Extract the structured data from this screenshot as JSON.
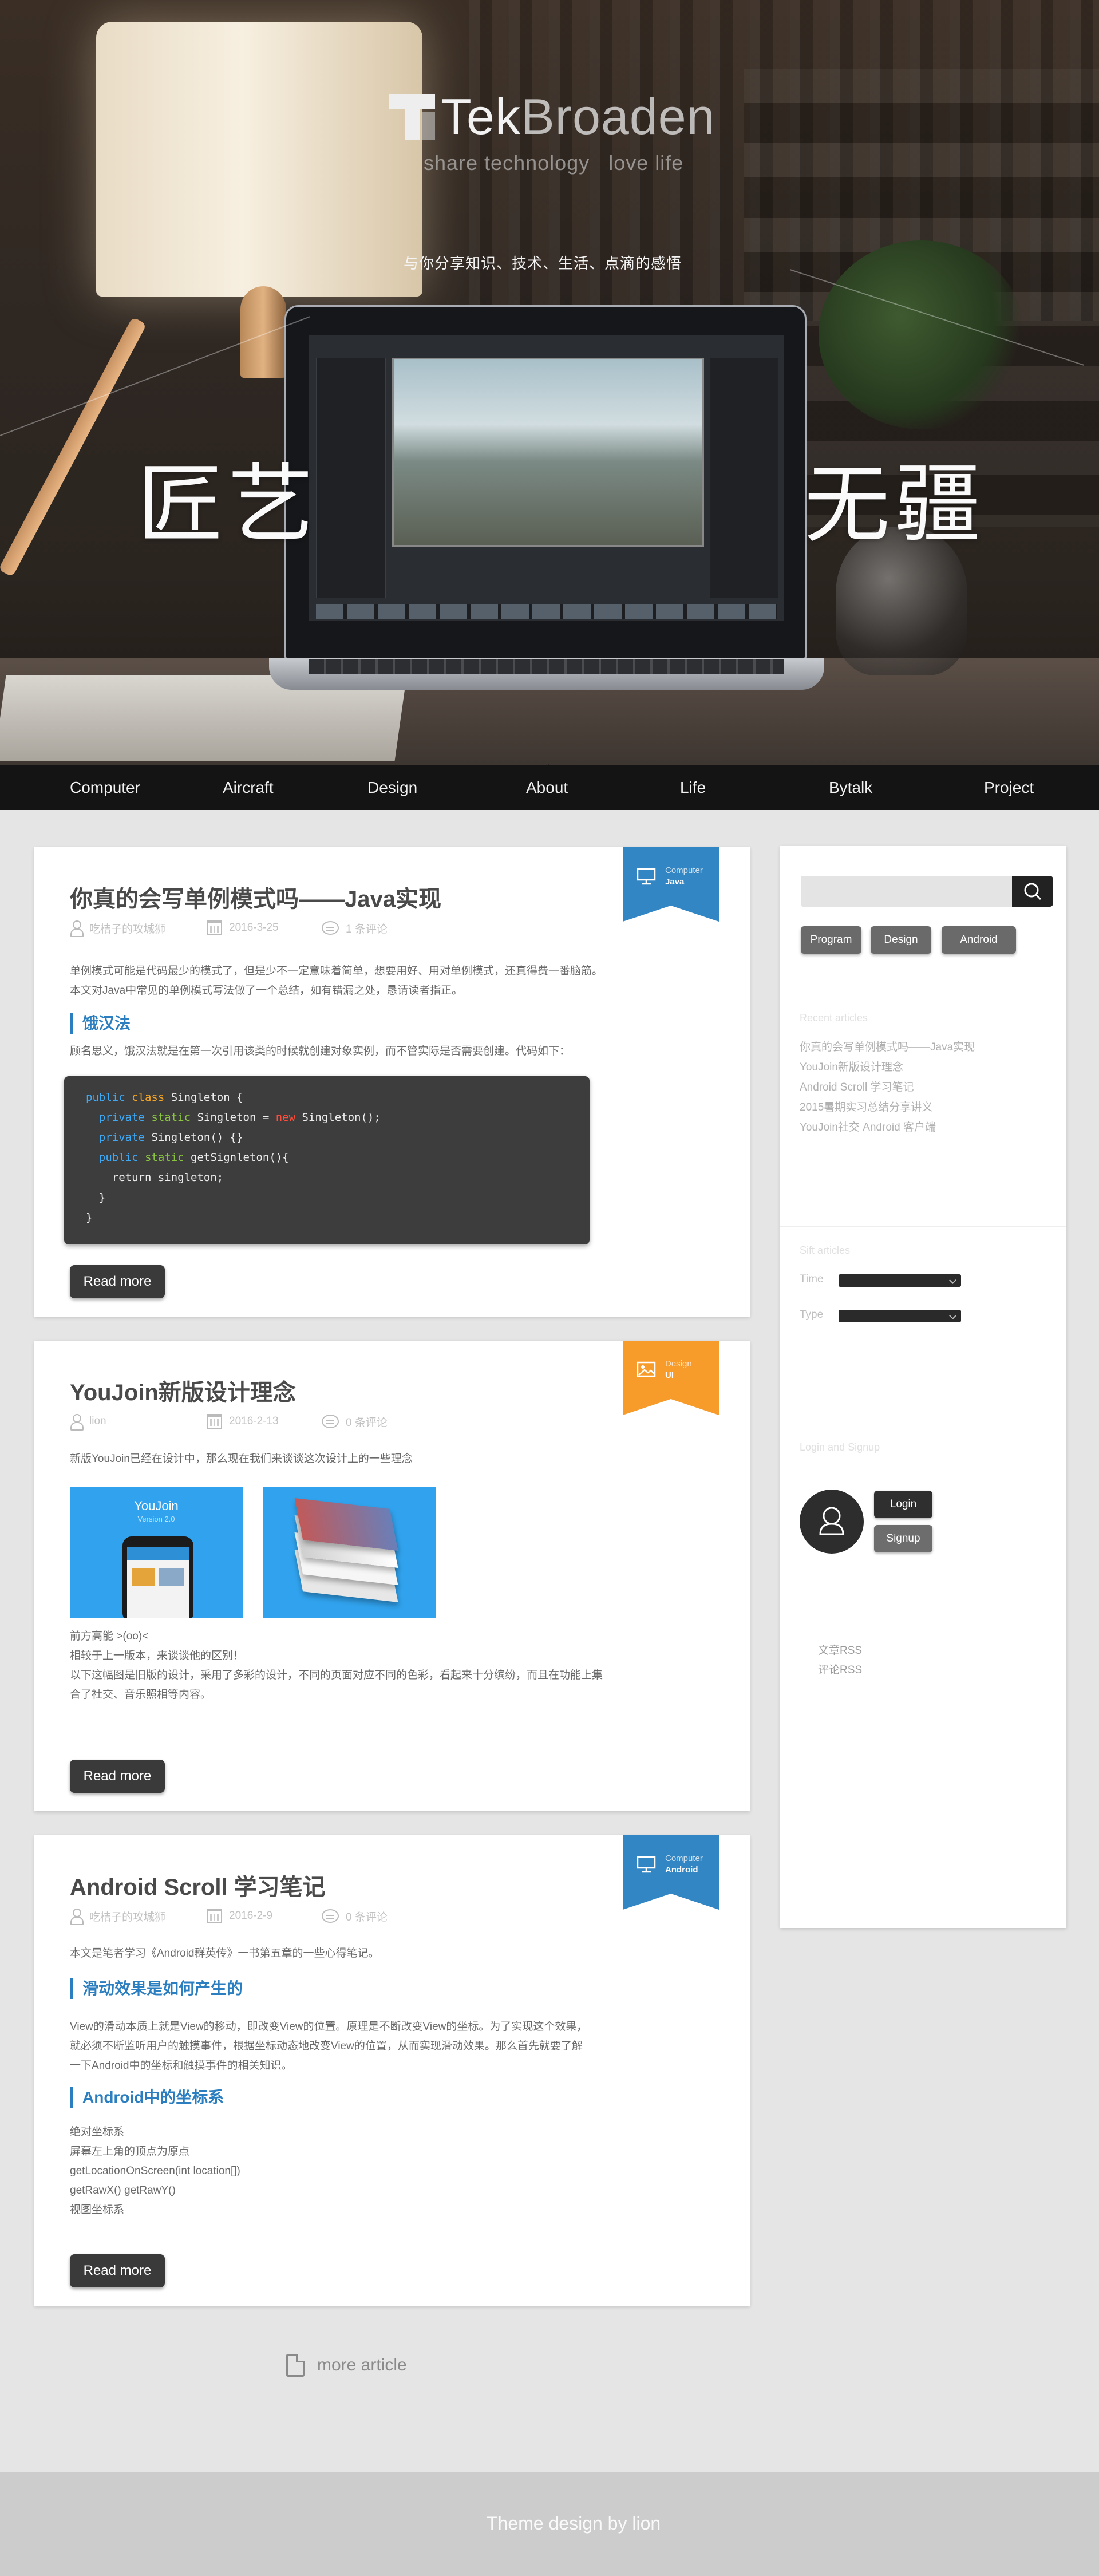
{
  "hero": {
    "logo_main": "Tek",
    "logo_light": "Broaden",
    "tagline": "share technology   love life",
    "share_line": "与你分享知识、技术、生活、点滴的感悟",
    "big_left": "匠艺",
    "big_right": "无疆"
  },
  "nav": {
    "items": [
      "Computer",
      "Aircraft",
      "Design",
      "About",
      "Life",
      "Bytalk",
      "Project"
    ]
  },
  "posts": [
    {
      "title": "你真的会写单例模式吗——Java实现",
      "author": "吃桔子的攻城狮",
      "date": "2016-3-25",
      "comments": "1 条评论",
      "ribbon_category": "Computer",
      "ribbon_sub": "Java",
      "ribbon_color": "#3386c4",
      "intro_1": "单例模式可能是代码最少的模式了，但是少不一定意味着简单，想要用好、用对单例模式，还真得费一番脑筋。",
      "intro_2": "本文对Java中常见的单例模式写法做了一个总结，如有错漏之处，恳请读者指正。",
      "heading": "饿汉法",
      "body": "顾名思义，饿汉法就是在第一次引用该类的时候就创建对象实例，而不管实际是否需要创建。代码如下：",
      "read_more": "Read more"
    },
    {
      "title": "YouJoin新版设计理念",
      "author": "lion",
      "date": "2016-2-13",
      "comments": "0 条评论",
      "ribbon_category": "Design",
      "ribbon_sub": "UI",
      "ribbon_color": "#f79b2a",
      "intro_1": "新版YouJoin已经在设计中，那么现在我们来谈谈这次设计上的一些理念",
      "thumb_title": "YouJoin",
      "thumb_version": "Version 2.0",
      "line_1": "前方高能 >(oo)<",
      "line_2": "相较于上一版本，来谈谈他的区别！",
      "line_3": "以下这幅图是旧版的设计，采用了多彩的设计，不同的页面对应不同的色彩，看起来十分缤纷，而且在功能上集",
      "line_4": "合了社交、音乐照相等内容。",
      "read_more": "Read more"
    },
    {
      "title": "Android Scroll 学习笔记",
      "author": "吃桔子的攻城狮",
      "date": "2016-2-9",
      "comments": "0 条评论",
      "ribbon_category": "Computer",
      "ribbon_sub": "Android",
      "ribbon_color": "#3386c4",
      "intro_1": "本文是笔者学习《Android群英传》一书第五章的一些心得笔记。",
      "heading_1": "滑动效果是如何产生的",
      "body_1": "View的滑动本质上就是View的移动，即改变View的位置。原理是不断改变View的坐标。为了实现这个效果，",
      "body_2": "就必须不断监听用户的触摸事件，根据坐标动态地改变View的位置，从而实现滑动效果。那么首先就要了解",
      "body_3": "一下Android中的坐标和触摸事件的相关知识。",
      "heading_2": "Android中的坐标系",
      "list": [
        "绝对坐标系",
        "屏幕左上角的顶点为原点",
        "getLocationOnScreen(int location[])",
        "getRawX() getRawY()",
        "视图坐标系"
      ],
      "read_more": "Read more"
    }
  ],
  "code_lines": [
    {
      "k1": "public",
      "k2": "class",
      "rest": " Singleton {"
    },
    {
      "k1": "  private",
      "k3": "static",
      "rest_a": " Singleton = ",
      "k4": "new",
      "rest_b": " Singleton();"
    },
    {
      "k1": "  private",
      "rest": " Singleton() {}"
    },
    {
      "k1": "  public",
      "k3": "static",
      "rest": " getSignleton(){"
    },
    {
      "plain": "    return singleton;"
    },
    {
      "plain": "  }"
    },
    {
      "plain": "}"
    }
  ],
  "more_article": "more article",
  "sidebar": {
    "search_placeholder": "",
    "tags": [
      "Program",
      "Design",
      "Android"
    ],
    "recent_head": "Recent articles",
    "recent": [
      "你真的会写单例模式吗——Java实现",
      "YouJoin新版设计理念",
      "Android Scroll 学习笔记",
      "2015暑期实习总结分享讲义",
      "YouJoin社交 Android 客户端"
    ],
    "sift_head": "Sift articles",
    "time_label": "Time",
    "type_label": "Type",
    "login_head": "Login and Signup",
    "login": "Login",
    "signup": "Signup",
    "rss_article": "文章RSS",
    "rss_comment": "评论RSS"
  },
  "footer": {
    "credit": "Theme design by lion"
  },
  "colors": {
    "accent_blue": "#2b7fc1",
    "ribbon_blue": "#3386c4",
    "ribbon_orange": "#f79b2a",
    "nav_bg": "#141414"
  }
}
